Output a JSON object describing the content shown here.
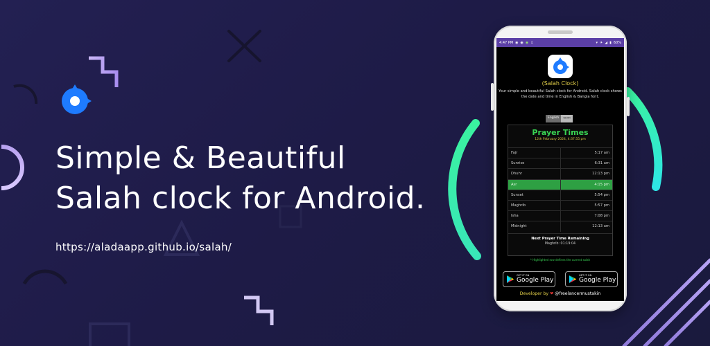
{
  "hero": {
    "line1": "Simple & Beautiful",
    "line2": "Salah clock for Android.",
    "url": "https://aladaapp.github.io/salah/"
  },
  "colors": {
    "accent": "#1e7bff",
    "brand_purple": "#5b3fa6",
    "active_row": "#2ea043",
    "title_green": "#39d353",
    "yellow": "#e6d24a",
    "arc_gradient": [
      "#3af2a0",
      "#2ee6d6"
    ]
  },
  "status_bar": {
    "time": "4:47 PM",
    "icons": [
      "chat-icon",
      "chat-icon",
      "chat-icon",
      "download-icon"
    ],
    "right_icons": [
      "wifi-icon",
      "airplane-icon",
      "signal-icon",
      "battery-icon"
    ],
    "battery": "60%"
  },
  "app": {
    "name": "(Salah Clock)",
    "description": "Your simple and beautiful Salah clock for Android. Salah clock shows the date and time in English & Bangla font.",
    "lang_options": [
      "English",
      "বাংলা"
    ],
    "selected_lang": "English"
  },
  "prayer": {
    "title": "Prayer Times",
    "date": "12th February 2024, 4:37:55 pm",
    "rows": [
      {
        "name": "Fajr",
        "time": "5:17 am",
        "active": false
      },
      {
        "name": "Sunrise",
        "time": "6:31 am",
        "active": false
      },
      {
        "name": "Dhuhr",
        "time": "12:13 pm",
        "active": false
      },
      {
        "name": "Asr",
        "time": "4:15 pm",
        "active": true
      },
      {
        "name": "Sunset",
        "time": "5:54 pm",
        "active": false
      },
      {
        "name": "Maghrib",
        "time": "5:57 pm",
        "active": false
      },
      {
        "name": "Isha",
        "time": "7:08 pm",
        "active": false
      },
      {
        "name": "Midnight",
        "time": "12:13 am",
        "active": false
      }
    ],
    "next_title": "Next Prayer Time Remaining",
    "next_value": "Maghrib: 01:19:04",
    "note": "* Highlighted row defines the current salah"
  },
  "store": {
    "badge_small": "GET IT ON",
    "badge_big": "Google Play"
  },
  "developer": {
    "prefix": "Developer by",
    "handle": "@freelancermustakin"
  }
}
